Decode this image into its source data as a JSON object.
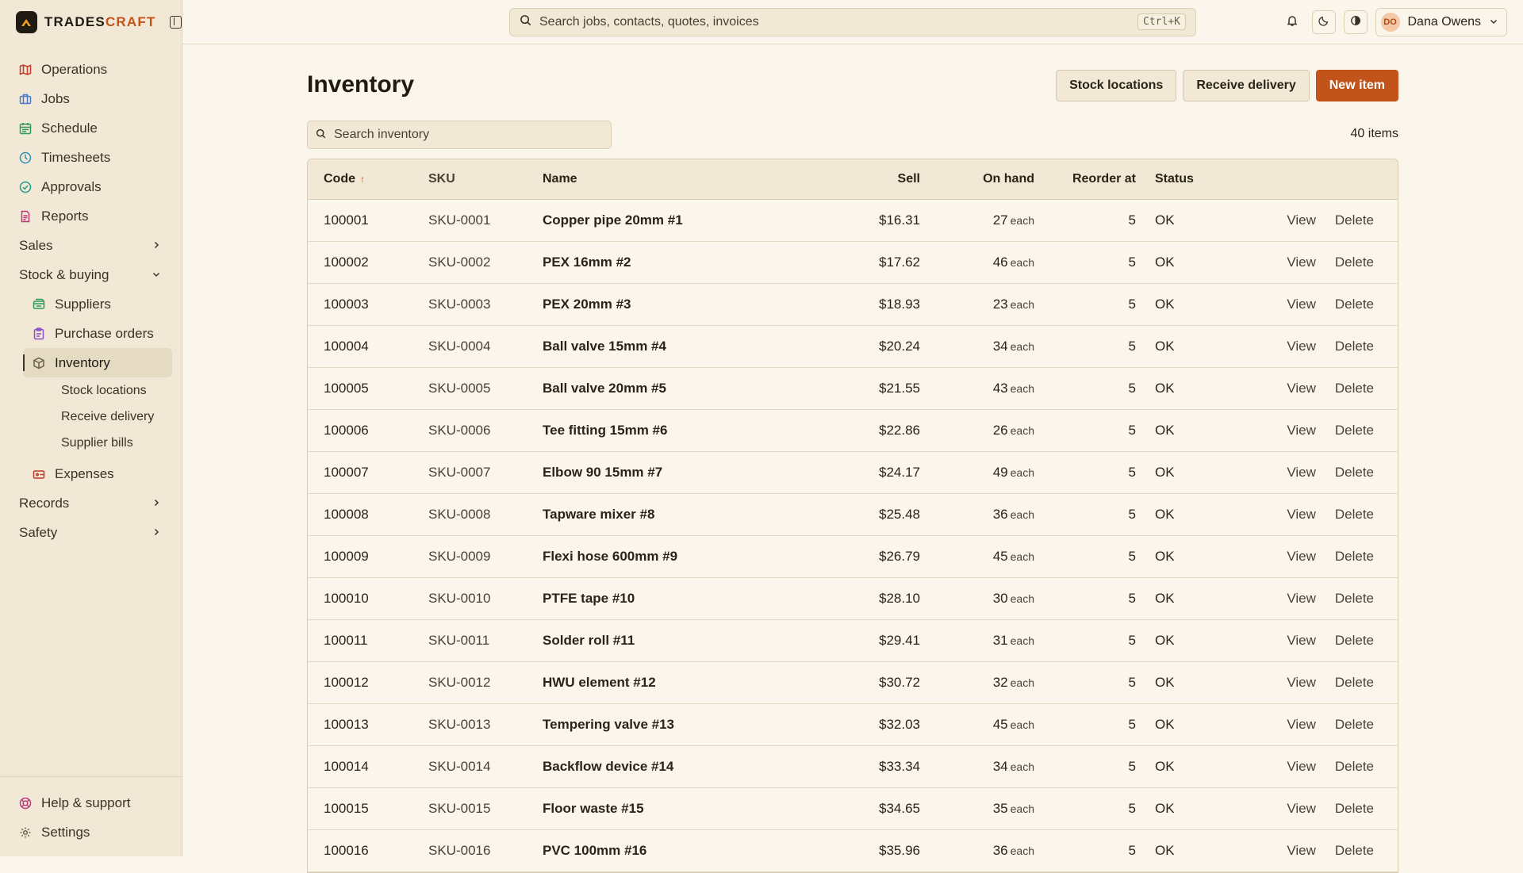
{
  "brand": {
    "name_a": "TRADES",
    "name_b": "CRAFT"
  },
  "sidebar": {
    "items": [
      {
        "label": "Operations",
        "icon": "map-icon",
        "color": "#c0392b"
      },
      {
        "label": "Jobs",
        "icon": "briefcase-icon",
        "color": "#4a78c8"
      },
      {
        "label": "Schedule",
        "icon": "calendar-icon",
        "color": "#2e9a5e"
      },
      {
        "label": "Timesheets",
        "icon": "clock-icon",
        "color": "#2a8fb5"
      },
      {
        "label": "Approvals",
        "icon": "check-circle-icon",
        "color": "#1f9e8a"
      },
      {
        "label": "Reports",
        "icon": "file-icon",
        "color": "#b8397a"
      }
    ],
    "groups": {
      "sales": "Sales",
      "stock": "Stock & buying",
      "records": "Records",
      "safety": "Safety"
    },
    "stock_items": [
      {
        "label": "Suppliers",
        "icon": "truck-icon",
        "color": "#2e9a5e"
      },
      {
        "label": "Purchase orders",
        "icon": "clipboard-icon",
        "color": "#8a4fc8"
      },
      {
        "label": "Inventory",
        "icon": "box-icon",
        "color": "#6a604d"
      }
    ],
    "inventory_sub": [
      "Stock locations",
      "Receive delivery",
      "Supplier bills"
    ],
    "expenses": {
      "label": "Expenses",
      "icon": "wallet-icon",
      "color": "#c0392b"
    },
    "bottom": [
      {
        "label": "Help & support",
        "icon": "lifebuoy-icon",
        "color": "#b8397a"
      },
      {
        "label": "Settings",
        "icon": "gear-icon",
        "color": "#6a604d"
      }
    ]
  },
  "topbar": {
    "search_placeholder": "Search jobs, contacts, quotes, invoices",
    "shortcut": "Ctrl+K",
    "user_initials": "DO",
    "user_name": "Dana Owens"
  },
  "main": {
    "title": "Inventory",
    "buttons": {
      "stock_locations": "Stock locations",
      "receive_delivery": "Receive delivery",
      "new_item": "New item"
    },
    "search_placeholder": "Search inventory",
    "count": "40 items"
  },
  "table": {
    "headers": {
      "code": "Code",
      "sku": "SKU",
      "name": "Name",
      "sell": "Sell",
      "onhand": "On hand",
      "reorder": "Reorder at",
      "status": "Status"
    },
    "actions": {
      "view": "View",
      "delete": "Delete"
    },
    "rows": [
      {
        "code": "100001",
        "sku": "SKU-0001",
        "name": "Copper pipe 20mm #1",
        "sell": "$16.31",
        "onhand": "27",
        "unit": "each",
        "reorder": "5",
        "status": "OK"
      },
      {
        "code": "100002",
        "sku": "SKU-0002",
        "name": "PEX 16mm #2",
        "sell": "$17.62",
        "onhand": "46",
        "unit": "each",
        "reorder": "5",
        "status": "OK"
      },
      {
        "code": "100003",
        "sku": "SKU-0003",
        "name": "PEX 20mm #3",
        "sell": "$18.93",
        "onhand": "23",
        "unit": "each",
        "reorder": "5",
        "status": "OK"
      },
      {
        "code": "100004",
        "sku": "SKU-0004",
        "name": "Ball valve 15mm #4",
        "sell": "$20.24",
        "onhand": "34",
        "unit": "each",
        "reorder": "5",
        "status": "OK"
      },
      {
        "code": "100005",
        "sku": "SKU-0005",
        "name": "Ball valve 20mm #5",
        "sell": "$21.55",
        "onhand": "43",
        "unit": "each",
        "reorder": "5",
        "status": "OK"
      },
      {
        "code": "100006",
        "sku": "SKU-0006",
        "name": "Tee fitting 15mm #6",
        "sell": "$22.86",
        "onhand": "26",
        "unit": "each",
        "reorder": "5",
        "status": "OK"
      },
      {
        "code": "100007",
        "sku": "SKU-0007",
        "name": "Elbow 90 15mm #7",
        "sell": "$24.17",
        "onhand": "49",
        "unit": "each",
        "reorder": "5",
        "status": "OK"
      },
      {
        "code": "100008",
        "sku": "SKU-0008",
        "name": "Tapware mixer #8",
        "sell": "$25.48",
        "onhand": "36",
        "unit": "each",
        "reorder": "5",
        "status": "OK"
      },
      {
        "code": "100009",
        "sku": "SKU-0009",
        "name": "Flexi hose 600mm #9",
        "sell": "$26.79",
        "onhand": "45",
        "unit": "each",
        "reorder": "5",
        "status": "OK"
      },
      {
        "code": "100010",
        "sku": "SKU-0010",
        "name": "PTFE tape #10",
        "sell": "$28.10",
        "onhand": "30",
        "unit": "each",
        "reorder": "5",
        "status": "OK"
      },
      {
        "code": "100011",
        "sku": "SKU-0011",
        "name": "Solder roll #11",
        "sell": "$29.41",
        "onhand": "31",
        "unit": "each",
        "reorder": "5",
        "status": "OK"
      },
      {
        "code": "100012",
        "sku": "SKU-0012",
        "name": "HWU element #12",
        "sell": "$30.72",
        "onhand": "32",
        "unit": "each",
        "reorder": "5",
        "status": "OK"
      },
      {
        "code": "100013",
        "sku": "SKU-0013",
        "name": "Tempering valve #13",
        "sell": "$32.03",
        "onhand": "45",
        "unit": "each",
        "reorder": "5",
        "status": "OK"
      },
      {
        "code": "100014",
        "sku": "SKU-0014",
        "name": "Backflow device #14",
        "sell": "$33.34",
        "onhand": "34",
        "unit": "each",
        "reorder": "5",
        "status": "OK"
      },
      {
        "code": "100015",
        "sku": "SKU-0015",
        "name": "Floor waste #15",
        "sell": "$34.65",
        "onhand": "35",
        "unit": "each",
        "reorder": "5",
        "status": "OK"
      },
      {
        "code": "100016",
        "sku": "SKU-0016",
        "name": "PVC 100mm #16",
        "sell": "$35.96",
        "onhand": "36",
        "unit": "each",
        "reorder": "5",
        "status": "OK"
      }
    ]
  },
  "colors": {
    "accent": "#c2531a",
    "sidebar_bg": "#f1e9d6",
    "page_bg": "#faf6ec"
  }
}
